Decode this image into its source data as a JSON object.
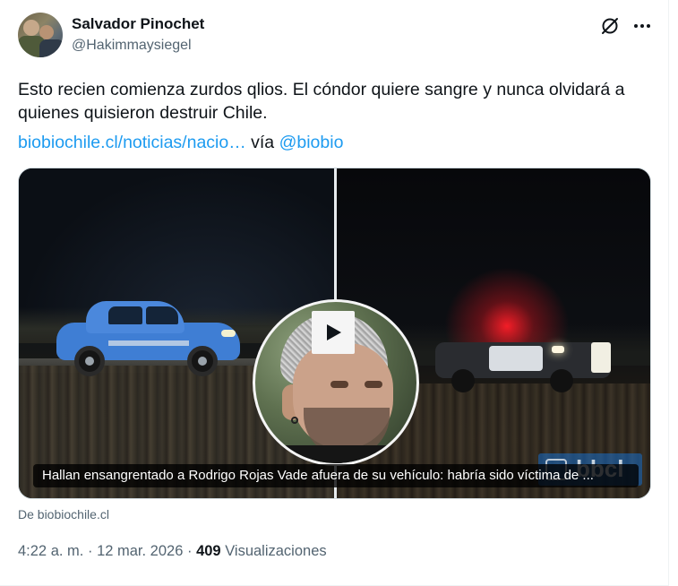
{
  "author": {
    "name": "Salvador Pinochet",
    "handle": "@Hakimmaysiegel"
  },
  "icons": {
    "grok": "grok-icon",
    "more": "more-options-icon",
    "play": "play-icon"
  },
  "post": {
    "text": "Esto recien comienza zurdos qlios. El cóndor quiere sangre y nunca olvidará a quienes quisieron destruir Chile.",
    "link_text": "biobiochile.cl/noticias/nacio…",
    "via_text": "vía",
    "mention": "@biobio"
  },
  "media": {
    "caption": "Hallan ensangrentado a Rodrigo Rojas Vade afuera de su vehículo: habría sido víctima de ...",
    "watermark": "bbcl"
  },
  "card": {
    "source": "De biobiochile.cl"
  },
  "meta": {
    "time": "4:22 a. m.",
    "separator": "·",
    "date": "12 mar. 2026",
    "views_count": "409",
    "views_label": "Visualizaciones"
  },
  "colors": {
    "link": "#1d9bf0",
    "text": "#0f1419",
    "muted": "#536471"
  }
}
